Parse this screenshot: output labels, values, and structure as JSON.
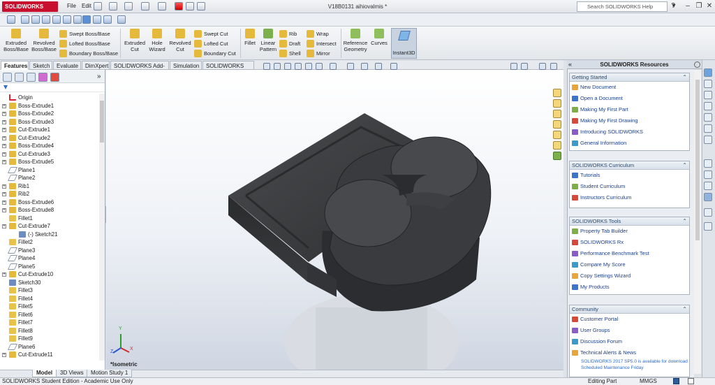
{
  "app": {
    "brand": "SOLIDWORKS",
    "doc_title": "V18B0131 aihiovalmis *"
  },
  "menu": {
    "file": "File",
    "edit": "Edit"
  },
  "search": {
    "placeholder": "Search SOLIDWORKS Help",
    "help_glyph": "?"
  },
  "commands": {
    "extruded_boss": "Extruded Boss/Base",
    "revolved_boss": "Revolved Boss/Base",
    "swept_boss": "Swept Boss/Base",
    "lofted_boss": "Lofted Boss/Base",
    "boundary_boss": "Boundary Boss/Base",
    "extruded_cut": "Extruded Cut",
    "hole_wizard": "Hole Wizard",
    "revolved_cut": "Revolved Cut",
    "swept_cut": "Swept Cut",
    "lofted_cut": "Lofted Cut",
    "boundary_cut": "Boundary Cut",
    "fillet": "Fillet",
    "linear_pattern": "Linear Pattern",
    "rib": "Rib",
    "draft": "Draft",
    "shell": "Shell",
    "wrap": "Wrap",
    "intersect": "Intersect",
    "mirror": "Mirror",
    "reference_geometry": "Reference Geometry",
    "curves": "Curves",
    "instant3d": "Instant3D"
  },
  "tabs": [
    "Features",
    "Sketch",
    "Evaluate",
    "DimXpert",
    "SOLIDWORKS Add-Ins",
    "Simulation",
    "SOLIDWORKS MBD"
  ],
  "tree": [
    {
      "label": "Origin",
      "expand": false,
      "child": false,
      "icon": "origin"
    },
    {
      "label": "Boss-Extrude1",
      "expand": true,
      "child": false,
      "icon": "feature"
    },
    {
      "label": "Boss-Extrude2",
      "expand": true,
      "child": false,
      "icon": "feature"
    },
    {
      "label": "Boss-Extrude3",
      "expand": true,
      "child": false,
      "icon": "feature"
    },
    {
      "label": "Cut-Extrude1",
      "expand": true,
      "child": false,
      "icon": "feature"
    },
    {
      "label": "Cut-Extrude2",
      "expand": true,
      "child": false,
      "icon": "feature"
    },
    {
      "label": "Boss-Extrude4",
      "expand": true,
      "child": false,
      "icon": "feature"
    },
    {
      "label": "Cut-Extrude3",
      "expand": true,
      "child": false,
      "icon": "feature"
    },
    {
      "label": "Boss-Extrude5",
      "expand": true,
      "child": false,
      "icon": "feature"
    },
    {
      "label": "Plane1",
      "expand": false,
      "child": false,
      "icon": "plane"
    },
    {
      "label": "Plane2",
      "expand": false,
      "child": false,
      "icon": "plane"
    },
    {
      "label": "Rib1",
      "expand": true,
      "child": false,
      "icon": "feature"
    },
    {
      "label": "Rib2",
      "expand": true,
      "child": false,
      "icon": "feature"
    },
    {
      "label": "Boss-Extrude6",
      "expand": true,
      "child": false,
      "icon": "feature"
    },
    {
      "label": "Boss-Extrude8",
      "expand": true,
      "child": false,
      "icon": "feature"
    },
    {
      "label": "Fillet1",
      "expand": false,
      "child": false,
      "icon": "fillet"
    },
    {
      "label": "Cut-Extrude7",
      "expand": true,
      "child": false,
      "icon": "feature"
    },
    {
      "label": "(-) Sketch21",
      "expand": false,
      "child": true,
      "icon": "sketch"
    },
    {
      "label": "Fillet2",
      "expand": false,
      "child": false,
      "icon": "fillet"
    },
    {
      "label": "Plane3",
      "expand": false,
      "child": false,
      "icon": "plane"
    },
    {
      "label": "Plane4",
      "expand": false,
      "child": false,
      "icon": "plane"
    },
    {
      "label": "Plane5",
      "expand": false,
      "child": false,
      "icon": "plane"
    },
    {
      "label": "Cut-Extrude10",
      "expand": true,
      "child": false,
      "icon": "feature"
    },
    {
      "label": "Sketch30",
      "expand": false,
      "child": false,
      "icon": "sketch"
    },
    {
      "label": "Fillet3",
      "expand": false,
      "child": false,
      "icon": "fillet"
    },
    {
      "label": "Fillet4",
      "expand": false,
      "child": false,
      "icon": "fillet"
    },
    {
      "label": "Fillet5",
      "expand": false,
      "child": false,
      "icon": "fillet"
    },
    {
      "label": "Fillet6",
      "expand": false,
      "child": false,
      "icon": "fillet"
    },
    {
      "label": "Fillet7",
      "expand": false,
      "child": false,
      "icon": "fillet"
    },
    {
      "label": "Fillet8",
      "expand": false,
      "child": false,
      "icon": "fillet"
    },
    {
      "label": "Fillet9",
      "expand": false,
      "child": false,
      "icon": "fillet"
    },
    {
      "label": "Plane6",
      "expand": false,
      "child": false,
      "icon": "plane"
    },
    {
      "label": "Cut-Extrude11",
      "expand": true,
      "child": false,
      "icon": "feature"
    }
  ],
  "viewport": {
    "view_label": "*Isometric",
    "triad": {
      "x": "X",
      "y": "Y",
      "z": "Z"
    }
  },
  "bottom_tabs": [
    "Model",
    "3D Views",
    "Motion Study 1"
  ],
  "status": {
    "left": "SOLIDWORKS Student Edition - Academic Use Only",
    "mode": "Editing Part",
    "units": "MMGS"
  },
  "taskpane": {
    "title": "SOLIDWORKS Resources",
    "sections": [
      {
        "title": "Getting Started",
        "items": [
          "New Document",
          "Open a Document",
          "Making My First Part",
          "Making My First Drawing",
          "Introducing SOLIDWORKS",
          "General Information"
        ]
      },
      {
        "title": "SOLIDWORKS Curriculum",
        "items": [
          "Tutorials",
          "Student Curriculum",
          "Instructors Curriculum"
        ]
      },
      {
        "title": "SOLIDWORKS Tools",
        "items": [
          "Property Tab Builder",
          "SOLIDWORKS Rx",
          "Performance Benchmark Test",
          "Compare My Score",
          "Copy Settings Wizard",
          "My Products"
        ]
      },
      {
        "title": "Community",
        "items": [
          "Customer Portal",
          "User Groups",
          "Discussion Forum",
          "Technical Alerts & News"
        ]
      }
    ],
    "news": [
      "SOLIDWORKS 2017 SP5.0 is available for download",
      "Scheduled Maintenance Friday"
    ]
  },
  "colors": {
    "brand": "#c8102e",
    "accent": "#2d4a6b",
    "model": "#3f4043"
  }
}
